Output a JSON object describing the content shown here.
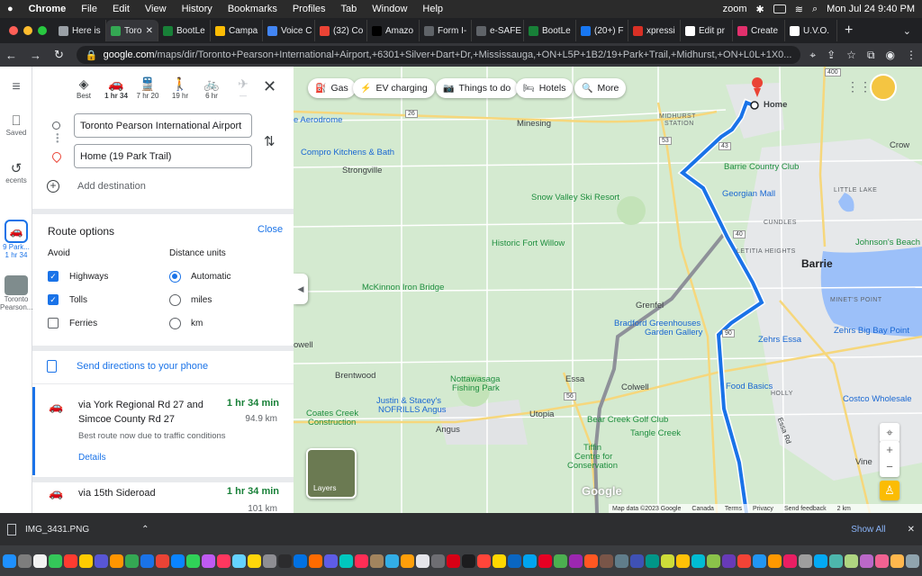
{
  "menubar": {
    "app": "Chrome",
    "items": [
      "File",
      "Edit",
      "View",
      "History",
      "Bookmarks",
      "Profiles",
      "Tab",
      "Window",
      "Help"
    ],
    "zoom_label": "zoom",
    "datetime": "Mon Jul 24  9:40 PM"
  },
  "tabs": [
    {
      "label": "Here is",
      "color": "#9aa0a6"
    },
    {
      "label": "Toro",
      "color": "#34a853",
      "active": true
    },
    {
      "label": "BootLe",
      "color": "#188038"
    },
    {
      "label": "Campa",
      "color": "#fbbc04"
    },
    {
      "label": "Voice C",
      "color": "#4285f4"
    },
    {
      "label": "(32) Co",
      "color": "#ea4335"
    },
    {
      "label": "Amazo",
      "color": "#000000"
    },
    {
      "label": "Form I-",
      "color": "#5f6368"
    },
    {
      "label": "e-SAFE",
      "color": "#5f6368"
    },
    {
      "label": "BootLe",
      "color": "#188038"
    },
    {
      "label": "(20+) F",
      "color": "#1877f2"
    },
    {
      "label": "xpressi",
      "color": "#d93025"
    },
    {
      "label": "Edit pr",
      "color": "#ffffff"
    },
    {
      "label": "Create",
      "color": "#e1306c"
    },
    {
      "label": "U.V.O.",
      "color": "#ffffff"
    }
  ],
  "toolbar": {
    "url_host": "google.com",
    "url_path": "/maps/dir/Toronto+Pearson+International+Airport,+6301+Silver+Dart+Dr,+Mississauga,+ON+L5P+1B2/19+Park+Trail,+Midhurst,+ON+L0L+1X0..."
  },
  "rail": {
    "saved": "Saved",
    "recents": "ecents",
    "recent1_line1": "9 Park...",
    "recent1_line2": "1 hr 34",
    "recent2_line1": "Toronto",
    "recent2_line2": "Pearson..."
  },
  "modes": [
    {
      "name": "best",
      "glyph": "◈",
      "label": "Best"
    },
    {
      "name": "drive",
      "glyph": "🚗",
      "label": "1 hr 34",
      "selected": true
    },
    {
      "name": "transit",
      "glyph": "🚆",
      "label": "7 hr 20"
    },
    {
      "name": "walk",
      "glyph": "🚶",
      "label": "19 hr"
    },
    {
      "name": "bike",
      "glyph": "🚲",
      "label": "6 hr"
    },
    {
      "name": "flight",
      "glyph": "✈",
      "label": "—"
    }
  ],
  "waypoints": {
    "origin": "Toronto Pearson International Airport",
    "destination": "Home (19 Park Trail)",
    "add": "Add destination"
  },
  "route_options": {
    "title": "Route options",
    "close": "Close",
    "avoid_title": "Avoid",
    "avoid": [
      {
        "label": "Highways",
        "checked": true
      },
      {
        "label": "Tolls",
        "checked": true
      },
      {
        "label": "Ferries",
        "checked": false
      }
    ],
    "units_title": "Distance units",
    "units": [
      {
        "label": "Automatic",
        "selected": true
      },
      {
        "label": "miles",
        "selected": false
      },
      {
        "label": "km",
        "selected": false
      }
    ]
  },
  "send_phone": "Send directions to your phone",
  "routes": [
    {
      "name": "via York Regional Rd 27 and Simcoe County Rd 27",
      "duration": "1 hr 34 min",
      "distance": "94.9 km",
      "desc": "Best route now due to traffic conditions",
      "details": "Details"
    },
    {
      "name": "via 15th Sideroad",
      "duration": "1 hr 34 min",
      "distance": "101 km"
    }
  ],
  "map": {
    "chips": [
      {
        "icon": "⛽",
        "label": "Gas"
      },
      {
        "icon": "⚡",
        "label": "EV charging"
      },
      {
        "icon": "📷",
        "label": "Things to do"
      },
      {
        "icon": "🛏",
        "label": "Hotels"
      },
      {
        "icon": "🔍",
        "label": "More"
      }
    ],
    "labels": {
      "aerodrome": "e Aerodrome",
      "minesing": "Minesing",
      "home": "Home",
      "midhurst": "MIDHURST",
      "station": "STATION",
      "crow": "Crow",
      "compro": "Compro Kitchens & Bath",
      "strongville": "Strongville",
      "barrie_cc": "Barrie Country Club",
      "georgian_mall": "Georgian Mall",
      "little_lake": "LITTLE LAKE",
      "snow_valley": "Snow Valley Ski Resort",
      "cundles": "CUNDLES",
      "historic_fort": "Historic Fort Willow",
      "johnsons_beach": "Johnson's Beach",
      "letitia": "LETITIA HEIGHTS",
      "barrie": "Barrie",
      "mckinnon": "McKinnon Iron Bridge",
      "minets": "MINET'S POINT",
      "grenfel": "Grenfel",
      "bradford": "Bradford Greenhouses",
      "bradford2": "Garden Gallery",
      "zehrs_essa": "Zehrs Essa",
      "zehrs_big_bay": "Zehrs Big Bay Point",
      "owell": "owell",
      "brentwood": "Brentwood",
      "nottawasaga": "Nottawasaga",
      "fishing_park": "Fishing Park",
      "essa": "Essa",
      "colwell": "Colwell",
      "food_basics": "Food Basics",
      "holly": "HOLLY",
      "costco": "Costco Wholesale",
      "justin": "Justin & Stacey's",
      "nofrills": "NOFRILLS Angus",
      "coates": "Coates Creek",
      "construction": "Construction",
      "utopia": "Utopia",
      "bear_creek": "Bear Creek Golf Club",
      "tangle": "Tangle Creek",
      "angus": "Angus",
      "tiffin": "Tiffin",
      "tiffin2": "Centre for",
      "tiffin3": "Conservation",
      "vine": "Vine",
      "essa_rd": "Essa Rd"
    },
    "roads": [
      "400",
      "26",
      "53",
      "43",
      "40",
      "90",
      "56",
      "27",
      "26"
    ],
    "layers": "Layers",
    "google": "Google",
    "attribution": [
      "Map data ©2023 Google",
      "Canada",
      "Terms",
      "Privacy",
      "Send feedback",
      "2 km"
    ]
  },
  "download": {
    "file": "IMG_3431.PNG",
    "show_all": "Show All"
  },
  "colors": {
    "route": "#1a73e8",
    "alt_route": "#8e9199",
    "water": "#9cc0f9",
    "map_bg": "#d4ead0"
  }
}
